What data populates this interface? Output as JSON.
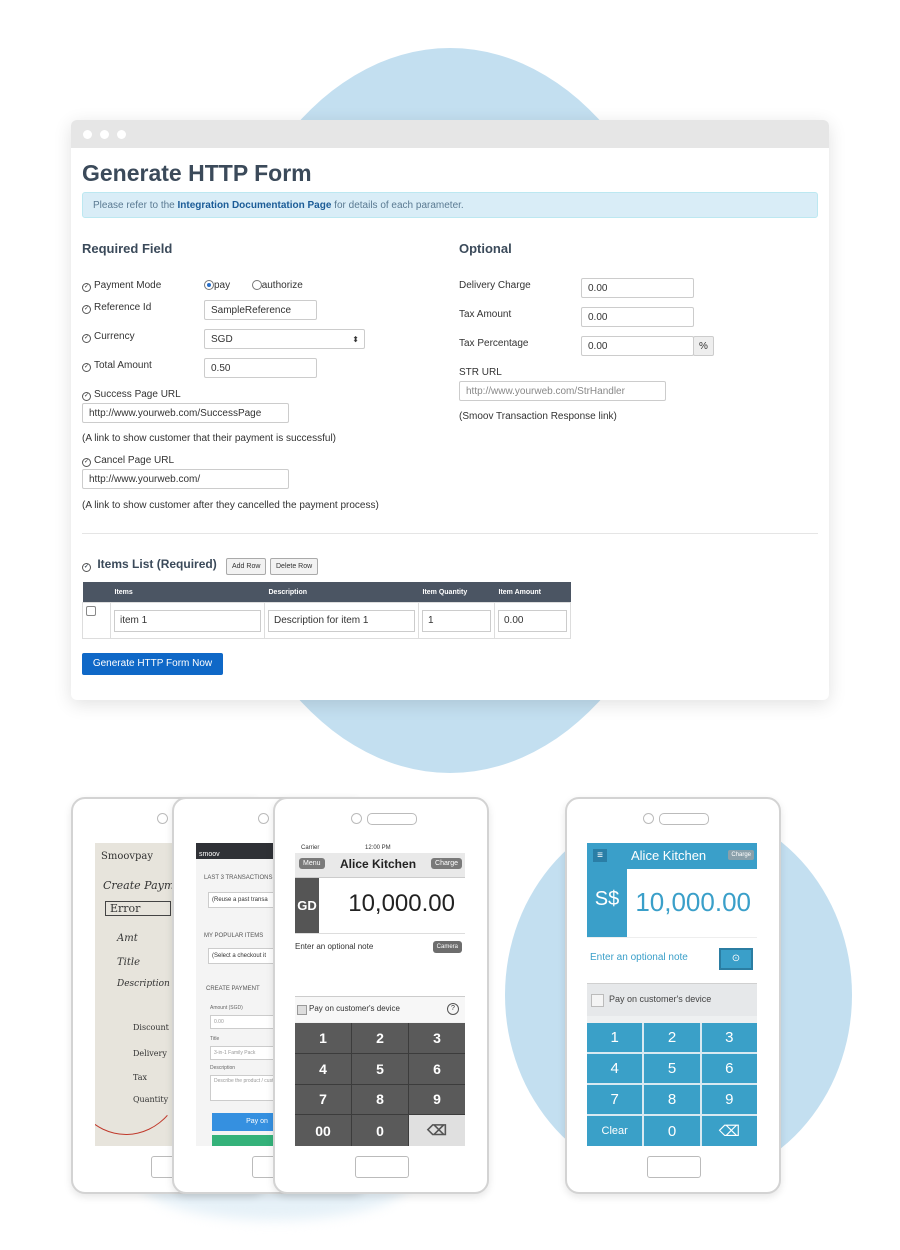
{
  "form": {
    "title": "Generate HTTP Form",
    "info_prefix": "Please refer to the ",
    "info_link": "Integration Documentation Page",
    "info_suffix": " for details of each parameter.",
    "required_heading": "Required Field",
    "optional_heading": "Optional",
    "payment_mode_label": "Payment Mode",
    "payment_pay": "pay",
    "payment_authorize": "authorize",
    "reference_label": "Reference Id",
    "reference_value": "SampleReference",
    "currency_label": "Currency",
    "currency_value": "SGD",
    "total_label": "Total Amount",
    "total_value": "0.50",
    "success_label": "Success Page URL",
    "success_value": "http://www.yourweb.com/SuccessPage",
    "success_note": "(A link to show customer that their payment is successful)",
    "cancel_label": "Cancel Page URL",
    "cancel_value": "http://www.yourweb.com/",
    "cancel_note": "(A link to show customer after they cancelled the payment process)",
    "delivery_label": "Delivery Charge",
    "delivery_value": "0.00",
    "tax_amount_label": "Tax Amount",
    "tax_amount_value": "0.00",
    "tax_pct_label": "Tax Percentage",
    "tax_pct_value": "0.00",
    "tax_pct_addon": "%",
    "str_label": "STR URL",
    "str_placeholder": "http://www.yourweb.com/StrHandler",
    "str_note": "(Smoov Transaction Response link)",
    "items_heading": "Items List (Required)",
    "add_row": "Add Row",
    "delete_row": "Delete Row",
    "table_headers": [
      "",
      "Items",
      "Description",
      "Item Quantity",
      "Item Amount"
    ],
    "row": {
      "item": "item 1",
      "description": "Description for item 1",
      "quantity": "1",
      "amount": "0.00"
    },
    "generate_button": "Generate HTTP Form Now"
  },
  "wireframe": {
    "brand": "smoov",
    "last3": "LAST 3 TRANSACTIONS",
    "reuse": "(Reuse a past transa",
    "popular": "MY POPULAR ITEMS",
    "select_checkout": "(Select a checkout it",
    "create_payment": "CREATE PAYMENT",
    "amount_label": "Amount (SGD)",
    "amount_ph": "0.00",
    "title_label": "Title",
    "title_ph": "3-in-1 Family Pack",
    "desc_label": "Description",
    "desc_ph": "Describe the product / customer",
    "pay_btn": "Pay on",
    "sketch_lines": [
      "Smoovpay",
      "Create Payme",
      "Error",
      "Amt",
      "Title",
      "Description",
      "Discount",
      "Delivery",
      "Tax",
      "Quantity"
    ]
  },
  "ios_app": {
    "carrier": "Carrier",
    "time": "12:00 PM",
    "menu": "Menu",
    "title": "Alice Kitchen",
    "charge": "Charge",
    "currency": "GD",
    "amount": "10,000.00",
    "note": "Enter an optional note",
    "camera": "Camera",
    "pay_device": "Pay on customer's device",
    "keys": [
      "1",
      "2",
      "3",
      "4",
      "5",
      "6",
      "7",
      "8",
      "9",
      "00",
      "0",
      "⌫"
    ]
  },
  "android_app": {
    "title": "Alice Kitchen",
    "charge": "Charge",
    "currency": "S$",
    "amount": "10,000.00",
    "note": "Enter an optional note",
    "pay_device": "Pay on customer's device",
    "keys": [
      "1",
      "2",
      "3",
      "4",
      "5",
      "6",
      "7",
      "8",
      "9",
      "Clear",
      "0",
      "⌫"
    ]
  },
  "colors": {
    "circle": "#c3dff0",
    "primary_button": "#0f68c7",
    "android_teal": "#3aa0c8",
    "ios_keypad": "#5a5a5a"
  }
}
